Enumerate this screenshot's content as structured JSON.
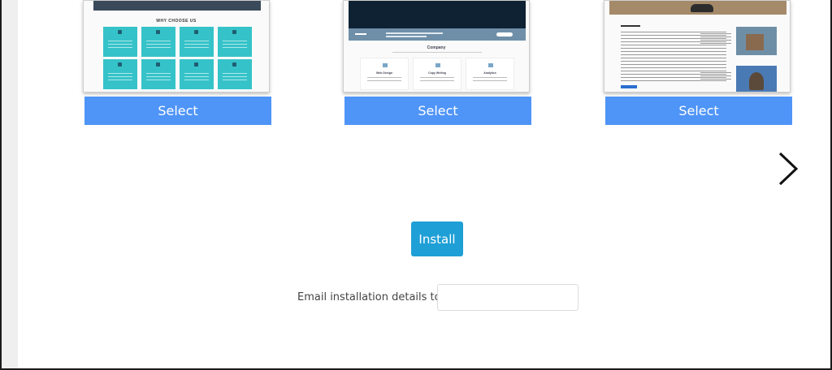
{
  "themes": [
    {
      "select_label": "Select",
      "preview_heading": "WHY CHOOSE US"
    },
    {
      "select_label": "Select",
      "preview_heading": "Company",
      "preview_columns": [
        "Web Design",
        "Copy Writing",
        "Analytics"
      ]
    },
    {
      "select_label": "Select"
    }
  ],
  "carousel": {
    "next_icon": "chevron-right-icon"
  },
  "install": {
    "label": "Install"
  },
  "email": {
    "label": "Email installation details to :",
    "value": "",
    "placeholder": ""
  },
  "colors": {
    "select_button": "#4f94f7",
    "install_button": "#1e9fd6",
    "tile_teal": "#35c3c9"
  }
}
